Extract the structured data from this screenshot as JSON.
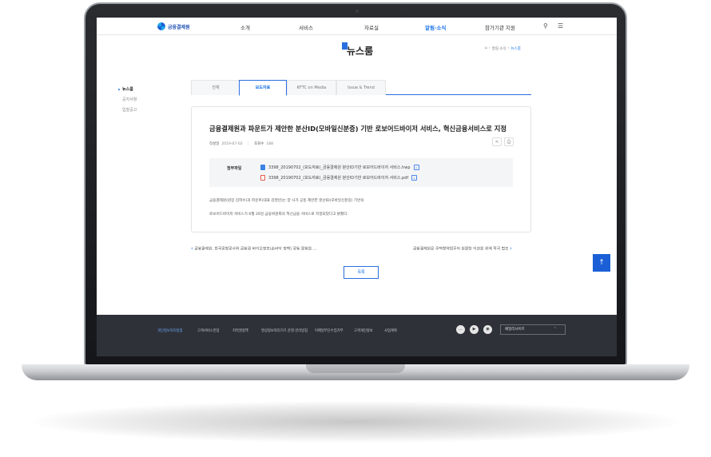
{
  "brand": {
    "name": "금융결제원",
    "accent": "#1a73e8"
  },
  "gnb": {
    "menus": [
      "소개",
      "서비스",
      "자료실",
      "알림·소식",
      "참가기관 지원"
    ],
    "active_index": 3,
    "icons": [
      "search-icon",
      "hamburger-icon"
    ]
  },
  "page": {
    "title": "뉴스룸",
    "breadcrumb": [
      "알림·소식",
      "뉴스룸"
    ]
  },
  "lnb": {
    "items": [
      "뉴스룸",
      "공지사항",
      "입찰공고"
    ],
    "active_index": 0
  },
  "tabs": {
    "items": [
      "전체",
      "보도자료",
      "KFTC on Media",
      "Issue & Trend"
    ],
    "active_index": 1
  },
  "post": {
    "title": "금융결제원과 파운트가 제안한 분산ID(모바일신분증) 기반 로보어드바이저 서비스, 혁신금융서비스로 지정",
    "date_label": "작성일",
    "date": "2019-07-02",
    "views_label": "조회수",
    "views": "188",
    "files_label": "첨부파일",
    "files": [
      {
        "type": "hwp",
        "name": "3398_20190702_(보도자료)_금융결제원 분산ID기반 로보어드바이저 서비스.hwp"
      },
      {
        "type": "pdf",
        "name": "3398_20190702_(보도자료)_금융결제원 분산ID기반 로보어드바이저 서비스.pdf"
      }
    ],
    "body": [
      "금융결제원(원장 김학수)과 파운트(대표 김영빈)는 양 사가 공동 제안한 분산ID(모바일신분증) 기반의",
      "로보어드바이저 서비스가 6월 26일 금융위원회의 혁신금융 서비스로 지정되었다고 밝혔다."
    ]
  },
  "nav": {
    "prev": "금융결제원, 한국공항공사와 금융권 바이오정보(손바닥 정맥) 공동 활용을 …",
    "next": "금융결제원은 주택청약업무의 원활한 이관을 위해 적극 협조"
  },
  "list_button": "목록",
  "footer": {
    "links": [
      "개인정보처리방침",
      "고객서비스헌장",
      "저작권정책",
      "영상정보처리기기 운영·관리방침",
      "이메일무단수집거부",
      "고객개인정보",
      "사업계획"
    ],
    "highlight_index": 0,
    "family_site": "패밀리사이트"
  }
}
